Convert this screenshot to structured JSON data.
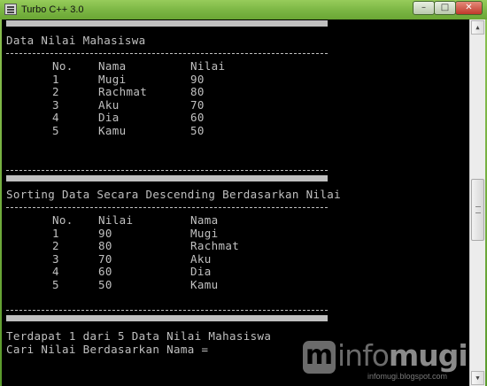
{
  "window": {
    "title": "Turbo C++ 3.0",
    "minimize": "–",
    "maximize": "□",
    "close": "✕"
  },
  "icons": {
    "app": "calculator-terminal-icon",
    "scroll_up": "▲",
    "scroll_down": "▼"
  },
  "console": {
    "section1_title": "Data Nilai Mahasiswa",
    "table1": {
      "headers": [
        "No.",
        "Nama",
        "Nilai"
      ],
      "rows": [
        [
          "1",
          "Mugi",
          "90"
        ],
        [
          "2",
          "Rachmat",
          "80"
        ],
        [
          "3",
          "Aku",
          "70"
        ],
        [
          "4",
          "Dia",
          "60"
        ],
        [
          "5",
          "Kamu",
          "50"
        ]
      ]
    },
    "section2_title": "Sorting Data Secara Descending Berdasarkan Nilai",
    "table2": {
      "headers": [
        "No.",
        "Nilai",
        "Nama"
      ],
      "rows": [
        [
          "1",
          "90",
          "Mugi"
        ],
        [
          "2",
          "80",
          "Rachmat"
        ],
        [
          "3",
          "70",
          "Aku"
        ],
        [
          "4",
          "60",
          "Dia"
        ],
        [
          "5",
          "50",
          "Kamu"
        ]
      ]
    },
    "result_line": "Terdapat 1 dari 5 Data Nilai Mahasiswa",
    "prompt_line": "Cari Nilai Berdasarkan Nama ="
  },
  "watermark": {
    "badge": "m",
    "word_a": "info",
    "word_b": "mugi",
    "url": "infomugi.blogspot.com"
  },
  "colors": {
    "titlebar": "#7ab543",
    "console_bg": "#000000",
    "console_text": "#c0c0c0"
  }
}
